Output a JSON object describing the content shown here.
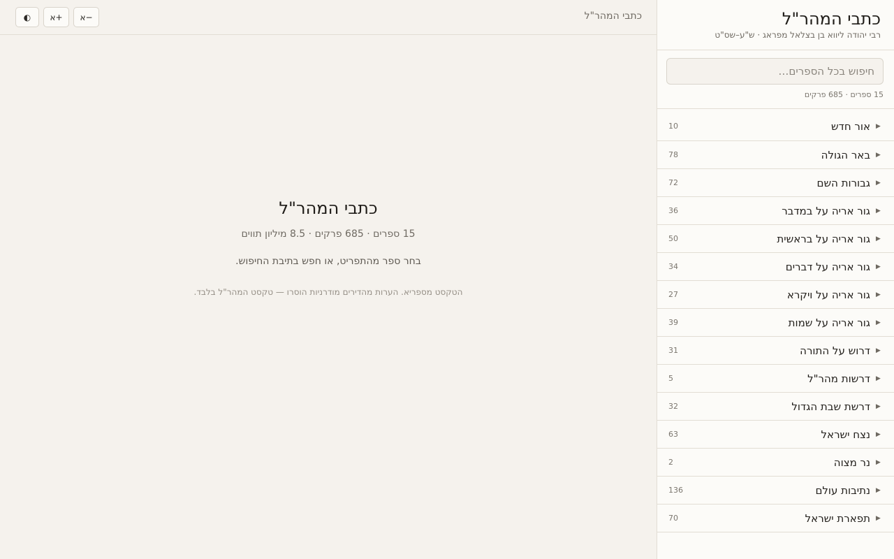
{
  "topbar": {
    "title": "כתבי המהר\"ל",
    "font_decrease_label": "א−",
    "font_increase_label": "א+",
    "theme_toggle_label": "◐"
  },
  "sidebar": {
    "title": "כתבי המהר\"ל",
    "subtitle": "רבי יהודה ליווא בן בצלאל מפראג · ש\"ע–שס\"ט",
    "search_placeholder": "חיפוש בכל הספרים…",
    "search_value": "",
    "stats": "15 ספרים · 685 פרקים",
    "books": [
      {
        "name": "אור חדש",
        "count": "10"
      },
      {
        "name": "באר הגולה",
        "count": "78"
      },
      {
        "name": "גבורות השם",
        "count": "72"
      },
      {
        "name": "גור אריה על במדבר",
        "count": "36"
      },
      {
        "name": "גור אריה על בראשית",
        "count": "50"
      },
      {
        "name": "גור אריה על דברים",
        "count": "34"
      },
      {
        "name": "גור אריה על ויקרא",
        "count": "27"
      },
      {
        "name": "גור אריה על שמות",
        "count": "39"
      },
      {
        "name": "דרוש על התורה",
        "count": "31"
      },
      {
        "name": "דרשות מהר\"ל",
        "count": "5"
      },
      {
        "name": "דרשת שבת הגדול",
        "count": "32"
      },
      {
        "name": "נצח ישראל",
        "count": "63"
      },
      {
        "name": "נר מצוה",
        "count": "2"
      },
      {
        "name": "נתיבות עולם",
        "count": "136"
      },
      {
        "name": "תפארת ישראל",
        "count": "70"
      }
    ],
    "arrow_icon": "triangle-expand-icon"
  },
  "welcome": {
    "title": "כתבי המהר\"ל",
    "stats": "15 ספרים · 685 פרקים · 8.5 מיליון תווים",
    "prompt": "בחר ספר מהתפריט, או חפש בתיבת החיפוש.",
    "note": "הטקסט מספריא. הערות מהדירים מודרניות הוסרו — טקסט המהר\"ל בלבד."
  },
  "colors": {
    "background": "#f5f2ed",
    "sidebar_background": "#fcfbf8",
    "border": "#e2ddd4",
    "text": "#2b2824",
    "muted_text": "#6f6a62"
  }
}
